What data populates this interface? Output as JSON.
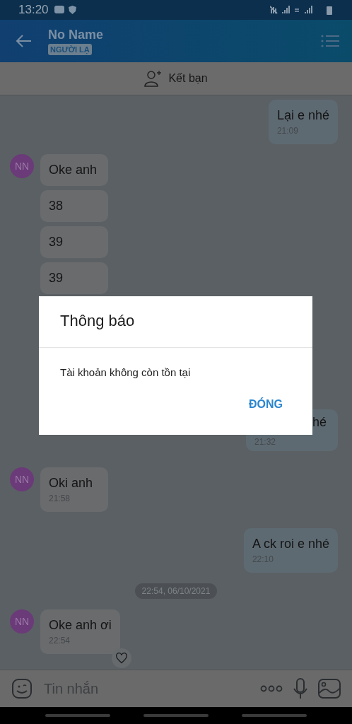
{
  "status_bar": {
    "time": "13:20"
  },
  "header": {
    "title": "No Name",
    "badge": "NGƯỜI LẠ"
  },
  "add_friend_bar": {
    "label": "Kết bạn"
  },
  "messages_above_dialog": [
    {
      "kind": "outgoing",
      "text": "Lại e nhé",
      "time": "21:09"
    },
    {
      "kind": "incoming",
      "text": "Oke anh",
      "avatar": "NN"
    },
    {
      "kind": "incoming",
      "text": "38"
    },
    {
      "kind": "incoming",
      "text": "39"
    },
    {
      "kind": "incoming",
      "text": "39"
    }
  ],
  "messages_below_dialog": [
    {
      "kind": "outgoing",
      "text": "hé",
      "time": "21:32"
    },
    {
      "kind": "incoming",
      "text": "Oki anh",
      "time": "21:58",
      "avatar": "NN"
    },
    {
      "kind": "outgoing",
      "text": "A ck roi e nhé",
      "time": "22:10"
    },
    {
      "kind": "date",
      "text": "22:54, 06/10/2021"
    },
    {
      "kind": "incoming",
      "text": "Oke anh ơi",
      "time": "22:54",
      "avatar": "NN",
      "liked": false
    }
  ],
  "composer": {
    "placeholder": "Tin nhắn"
  },
  "dialog": {
    "title": "Thông báo",
    "message": "Tài khoản không còn tồn tại",
    "button": "ĐÓNG"
  }
}
